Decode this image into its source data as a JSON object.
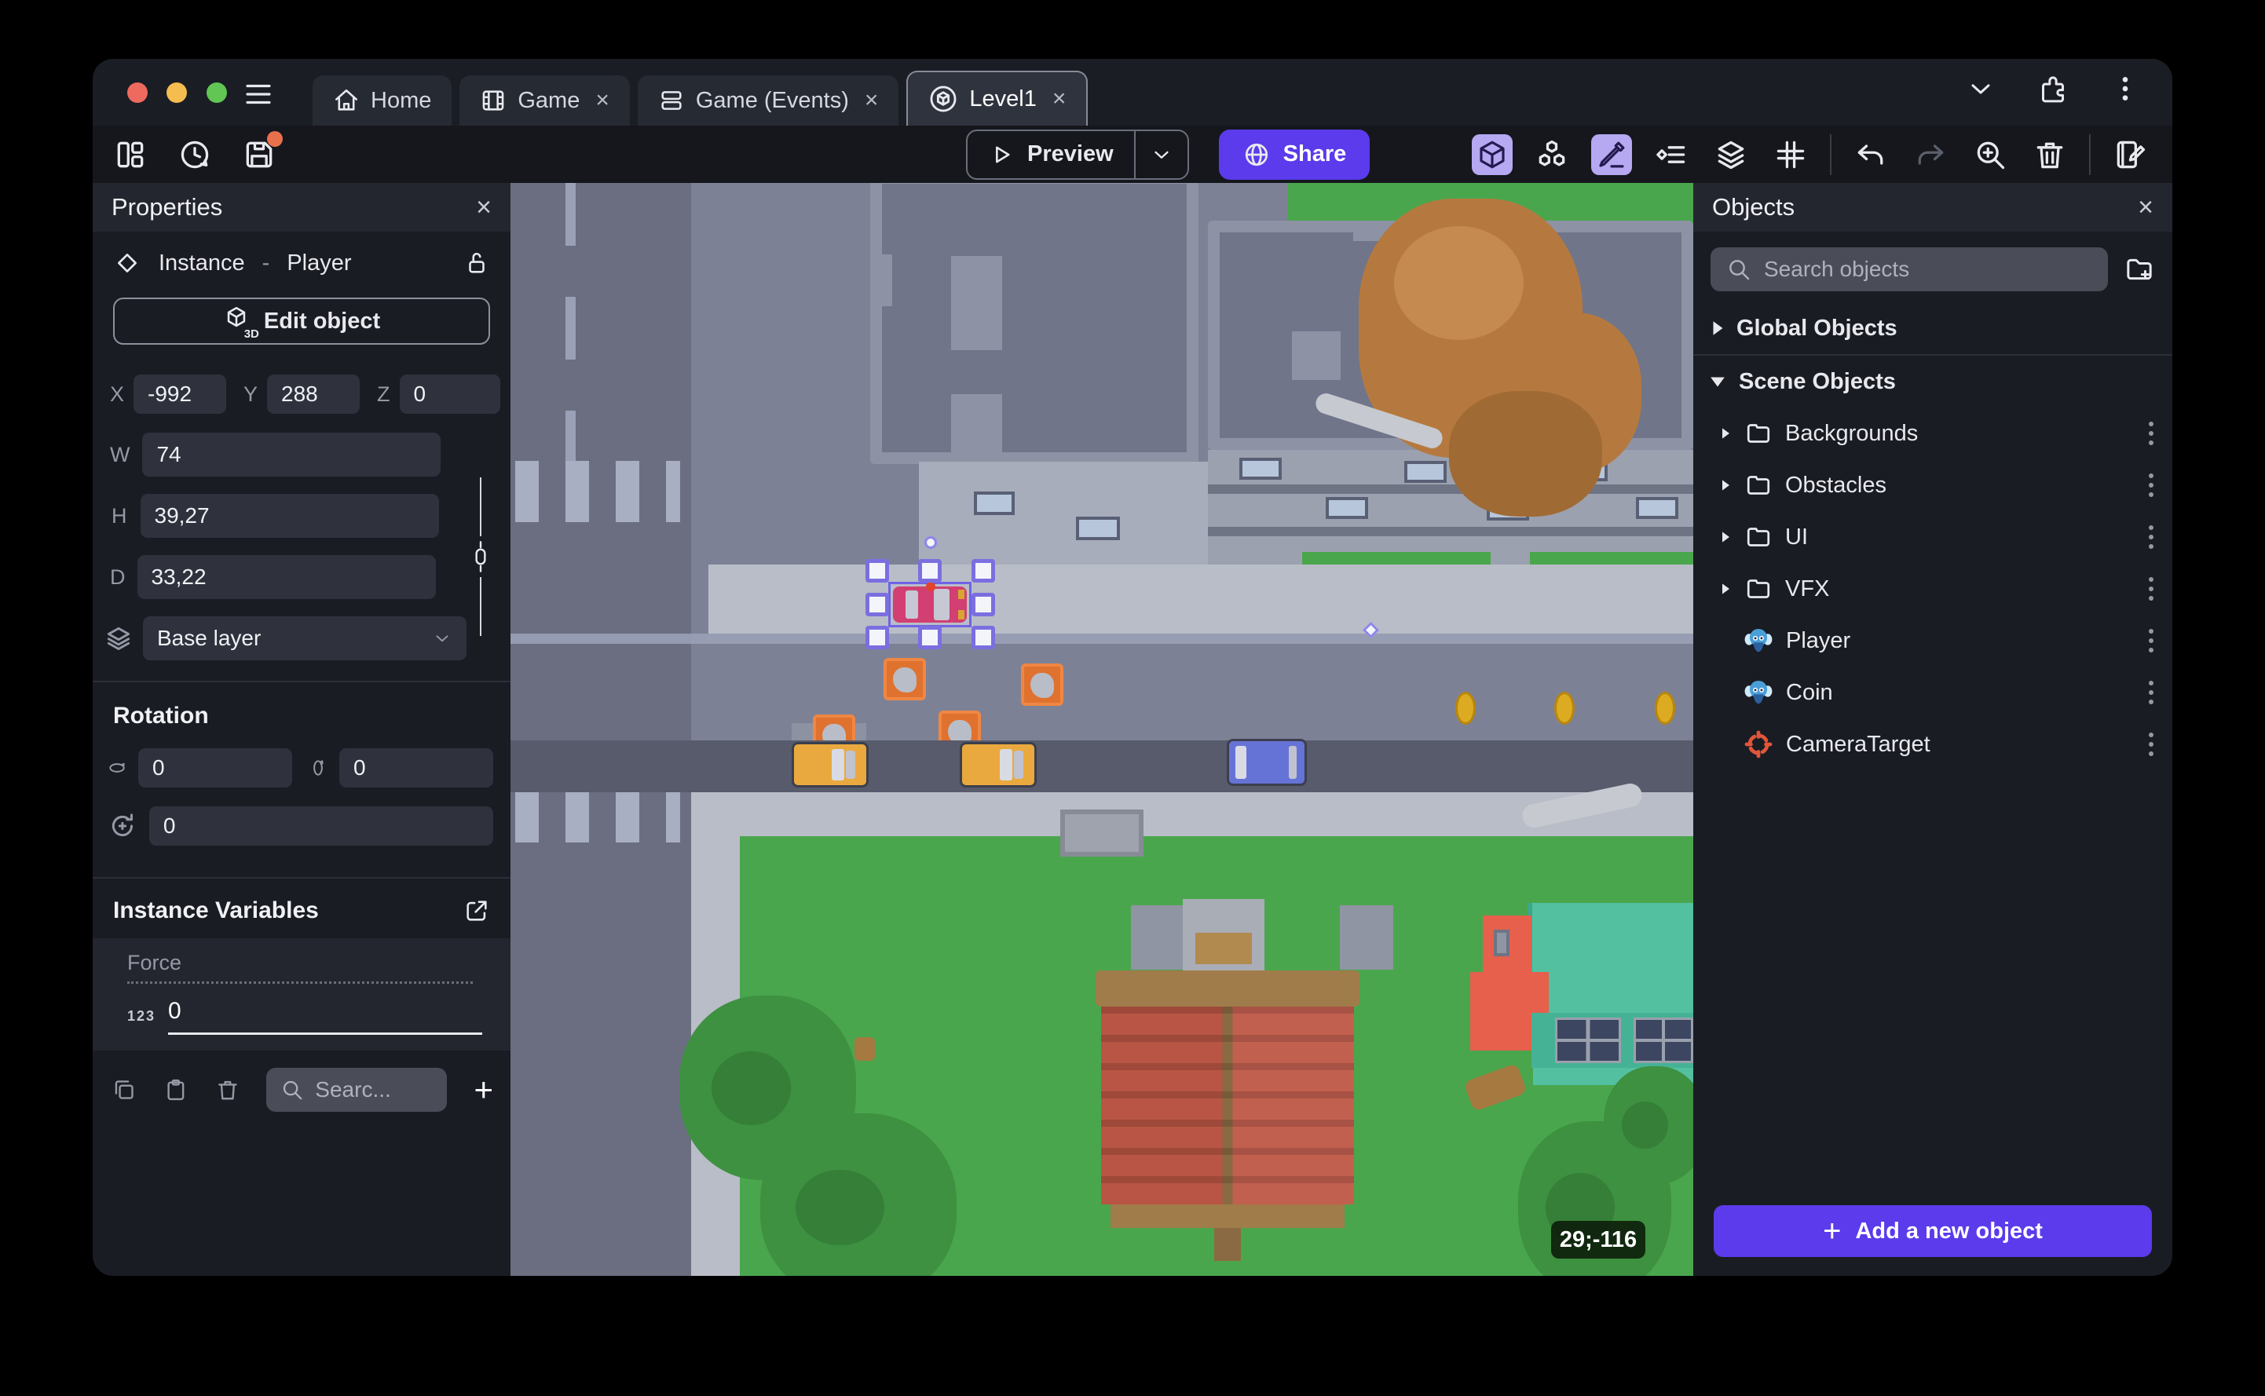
{
  "window": {
    "close_glyph": "×",
    "plus_glyph": "+",
    "tabs": [
      {
        "label": "Home"
      },
      {
        "label": "Game"
      },
      {
        "label": "Game (Events)"
      },
      {
        "label": "Level1"
      }
    ]
  },
  "toolbar": {
    "preview_label": "Preview",
    "share_label": "Share"
  },
  "properties_panel": {
    "title": "Properties",
    "instance": {
      "type_label": "Instance",
      "separator": "-",
      "object_name": "Player"
    },
    "edit_object_label": "Edit object",
    "edit_object_icon_label": "3D",
    "position": {
      "x_label": "X",
      "x": "-992",
      "y_label": "Y",
      "y": "288",
      "z_label": "Z",
      "z": "0"
    },
    "size": {
      "w_label": "W",
      "w": "74",
      "h_label": "H",
      "h": "39,27",
      "d_label": "D",
      "d": "33,22"
    },
    "layer": {
      "value": "Base layer"
    },
    "rotation": {
      "title": "Rotation",
      "x": "0",
      "y": "0",
      "z": "0"
    },
    "instance_variables": {
      "title": "Instance Variables",
      "rows": [
        {
          "name": "Force",
          "type_badge": "123",
          "value": "0"
        }
      ],
      "search_placeholder": "Searc..."
    }
  },
  "objects_panel": {
    "title": "Objects",
    "search_placeholder": "Search objects",
    "groups": [
      {
        "label": "Global Objects"
      },
      {
        "label": "Scene Objects"
      }
    ],
    "scene_objects": [
      {
        "label": "Backgrounds",
        "kind": "folder"
      },
      {
        "label": "Obstacles",
        "kind": "folder"
      },
      {
        "label": "UI",
        "kind": "folder"
      },
      {
        "label": "VFX",
        "kind": "folder"
      },
      {
        "label": "Player",
        "kind": "sprite"
      },
      {
        "label": "Coin",
        "kind": "sprite"
      },
      {
        "label": "CameraTarget",
        "kind": "target"
      }
    ],
    "add_button_label": "Add a new object"
  },
  "canvas": {
    "cursor_coordinates": "29;-116"
  },
  "colors": {
    "accent_purple": "#5b3beb",
    "active_toggle": "#b7a8f2",
    "grass": "#4aa64d",
    "road": "#7d8196",
    "dark_road": "#575b6c",
    "selection": "#7b6fe0",
    "unsaved_dot": "#e8704c"
  }
}
